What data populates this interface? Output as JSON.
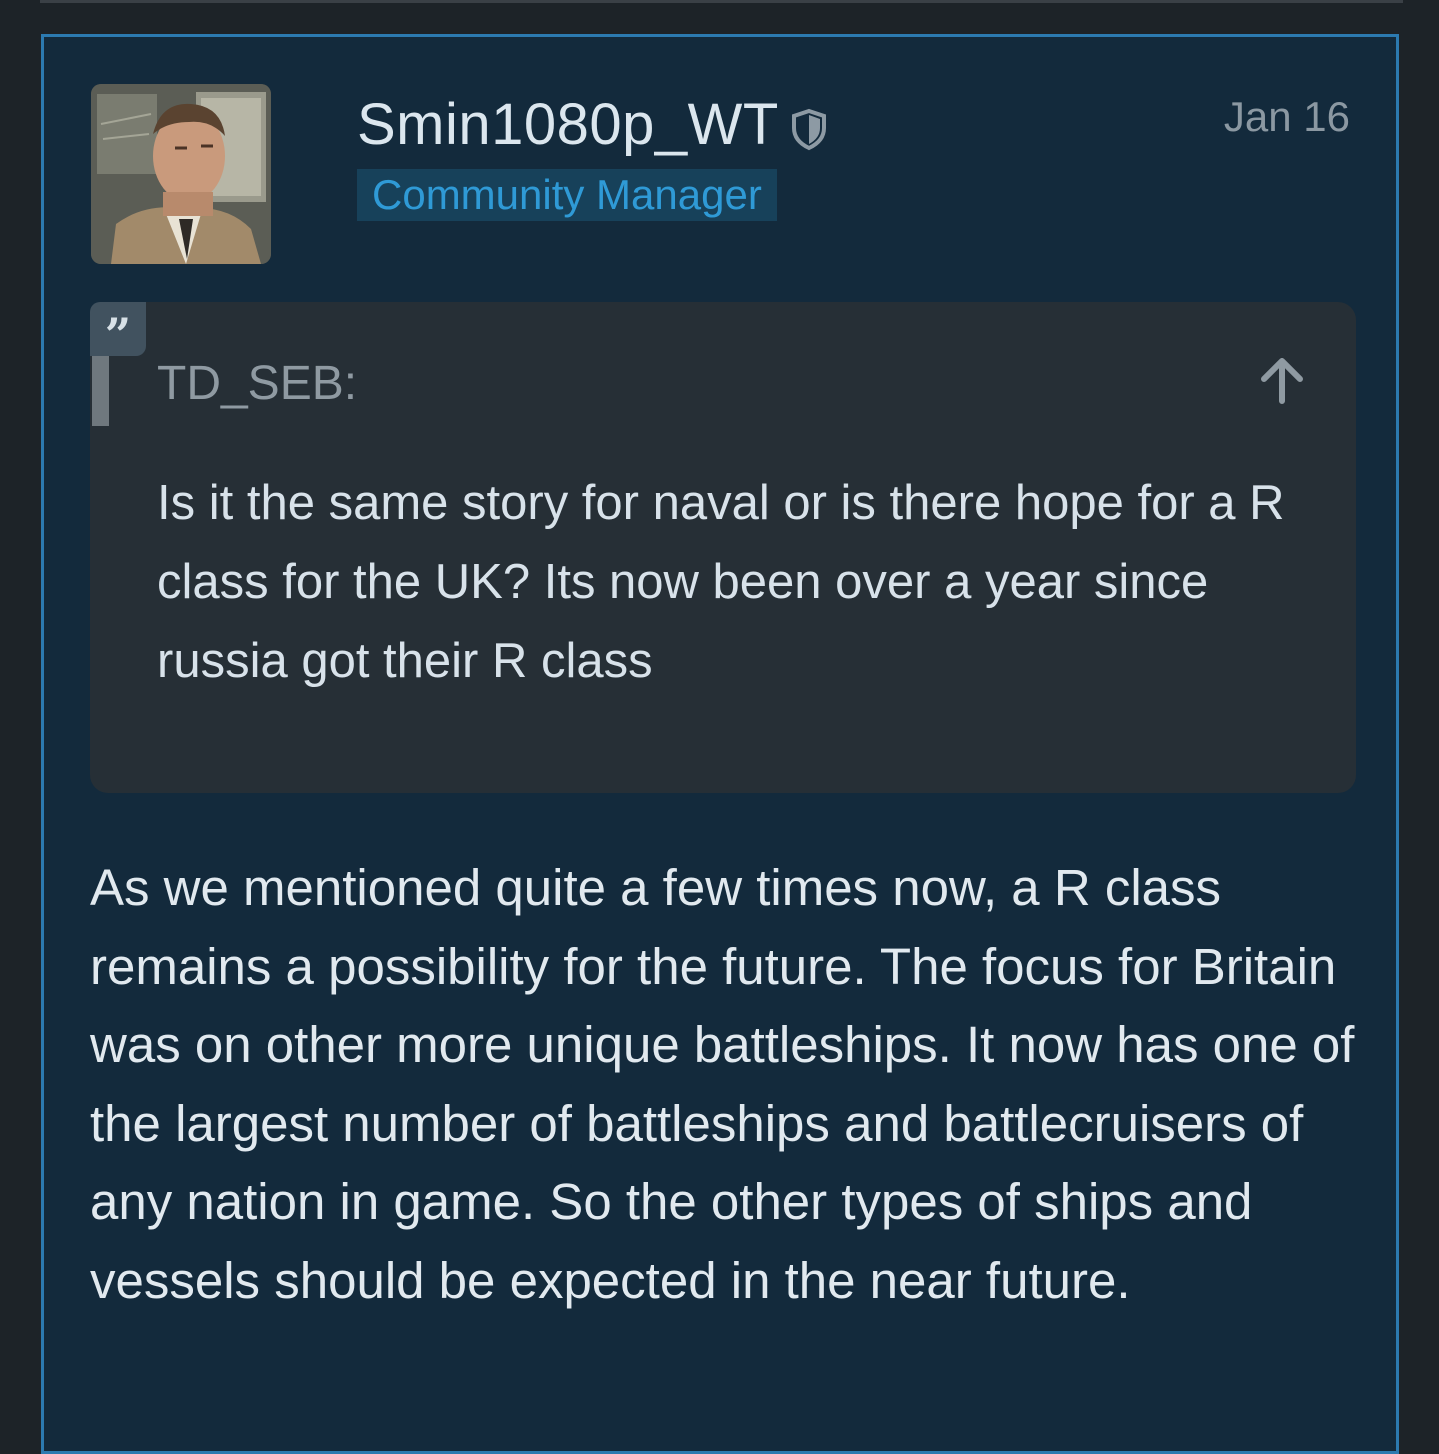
{
  "post": {
    "author": {
      "username": "Smin1080p_WT",
      "title": "Community Manager",
      "moderator_icon": "shield-icon",
      "avatar_icon": "avatar"
    },
    "date": "Jan 16",
    "quote": {
      "icon": "quote-icon",
      "author": "TD_SEB:",
      "jump_icon": "arrow-up-icon",
      "text": "Is it the same story for naval or is there hope for a R class for the UK? Its now been over a year since russia got their R class"
    },
    "body": "As we mentioned quite a few times now, a R class remains a possibility for the future. The focus for Britain was on other more unique battleships. It now has one of the largest number of battleships and battlecruisers of any nation in game. So the other types of ships and vessels should be expected in the near future."
  },
  "colors": {
    "card_background": "#132a3c",
    "card_border": "#2c7ab0",
    "quote_background": "#262f36",
    "title_text": "#2f9ad6",
    "title_background": "#17415a"
  }
}
